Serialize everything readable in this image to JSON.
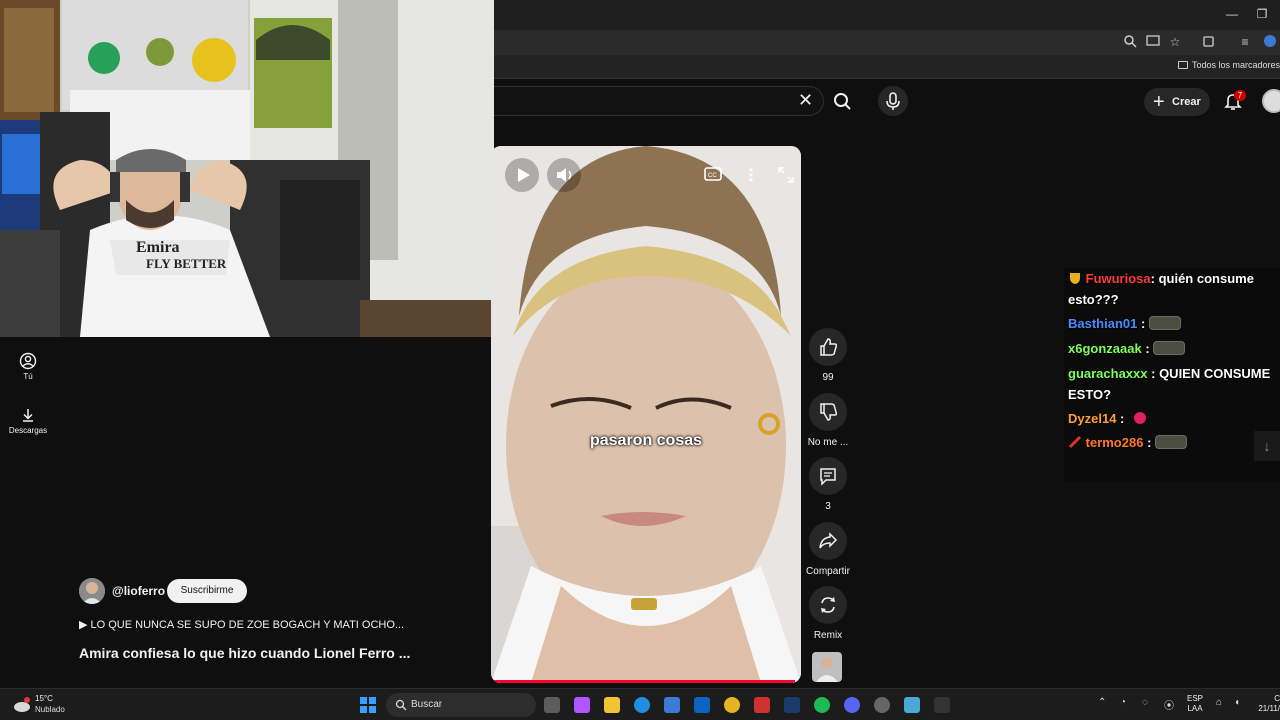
{
  "browser": {
    "bookmarks_folder": "Todos los marcadores",
    "window_buttons": {
      "minimize": "—",
      "restore": "❐"
    }
  },
  "youtube": {
    "clear_search_glyph": "✕",
    "create_label": "Crear",
    "notification_count": "7",
    "sidebar": [
      {
        "label": "Tú",
        "icon": "account-circle-icon"
      },
      {
        "label": "Descargas",
        "icon": "download-icon"
      }
    ],
    "channel": {
      "handle": "@lioferro",
      "subscribe_label": "Suscribirme"
    },
    "playlist_line": "▶ LO QUE NUNCA SE SUPO DE ZOE BOGACH Y MATI OCHO...",
    "video_title": "Amira confiesa lo que hizo cuando Lionel Ferro ...",
    "short": {
      "subtitle": "pasaron cosas",
      "progress_fraction": 0.98,
      "progress_color": "#ff0033"
    },
    "actions": [
      {
        "label": "99",
        "icon": "like-icon"
      },
      {
        "label": "No me ...",
        "icon": "dislike-icon"
      },
      {
        "label": "3",
        "icon": "comment-icon"
      },
      {
        "label": "Compartir",
        "icon": "share-icon"
      },
      {
        "label": "Remix",
        "icon": "remix-icon"
      }
    ]
  },
  "chat": {
    "messages": [
      {
        "user": "Fuwuriosa",
        "user_color": "#ff3b3b",
        "text": ": quién consume esto???"
      },
      {
        "user": "Basthian01",
        "user_color": "#4a8cff",
        "text": ":"
      },
      {
        "user": "x6gonzaaak",
        "user_color": "#7cff5a",
        "text": ":"
      },
      {
        "user": "guarachaxxx",
        "user_color": "#7cff5a",
        "text": ": QUIEN CONSUME ESTO?"
      },
      {
        "user": "Dyzel14",
        "user_color": "#ff9f3b",
        "text": ":"
      },
      {
        "user": "termo286",
        "user_color": "#ff7a2a",
        "text": ":"
      }
    ]
  },
  "taskbar": {
    "weather_temp": "15°C",
    "weather_condition": "Nublado",
    "search_label": "Buscar",
    "lang_line1": "ESP",
    "lang_line2": "LAA",
    "clock_line1": "C",
    "clock_line2": "21/11/"
  }
}
